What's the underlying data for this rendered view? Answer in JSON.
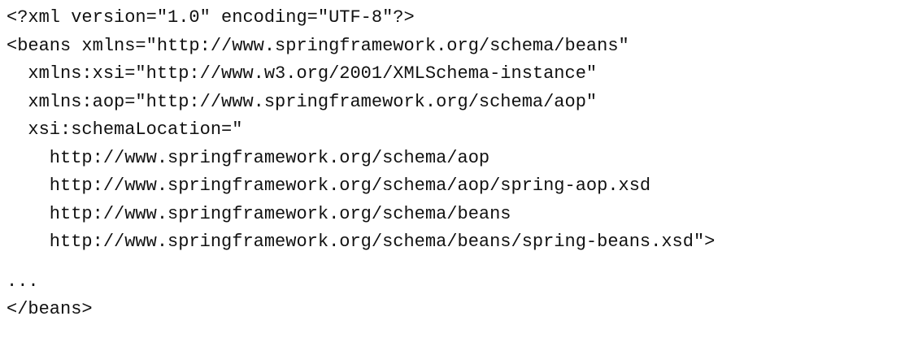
{
  "code": {
    "lines": [
      "<?xml version=\"1.0\" encoding=\"UTF-8\"?>",
      "<beans xmlns=\"http://www.springframework.org/schema/beans\"",
      "  xmlns:xsi=\"http://www.w3.org/2001/XMLSchema-instance\"",
      "  xmlns:aop=\"http://www.springframework.org/schema/aop\"",
      "  xsi:schemaLocation=\"",
      "    http://www.springframework.org/schema/aop",
      "    http://www.springframework.org/schema/aop/spring-aop.xsd",
      "    http://www.springframework.org/schema/beans",
      "    http://www.springframework.org/schema/beans/spring-beans.xsd\">",
      "...",
      "</beans>"
    ]
  }
}
